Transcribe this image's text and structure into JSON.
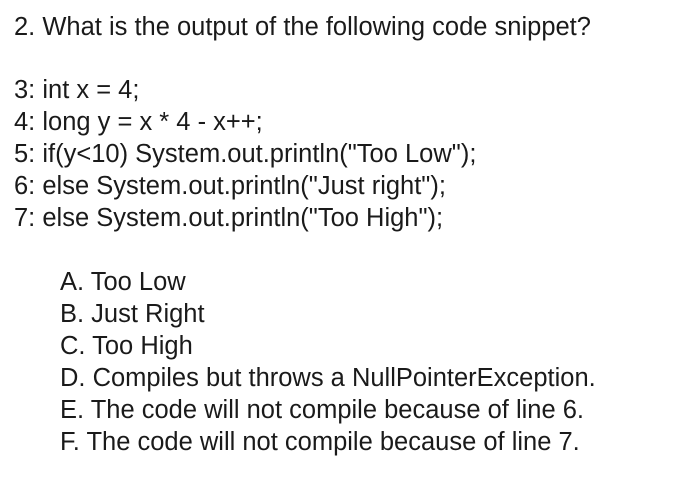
{
  "question": {
    "text": "2. What is the output of the following code snippet?"
  },
  "code": {
    "lines": [
      "3: int x = 4;",
      "4: long y = x * 4 - x++;",
      "5: if(y<10) System.out.println(\"Too Low\");",
      "6: else System.out.println(\"Just right\");",
      "7: else System.out.println(\"Too High\");"
    ]
  },
  "options": [
    "A. Too Low",
    "B. Just Right",
    "C. Too High",
    "D. Compiles but throws a NullPointerException.",
    "E. The code will not compile because of line 6.",
    "F. The code will not compile because of line 7."
  ]
}
